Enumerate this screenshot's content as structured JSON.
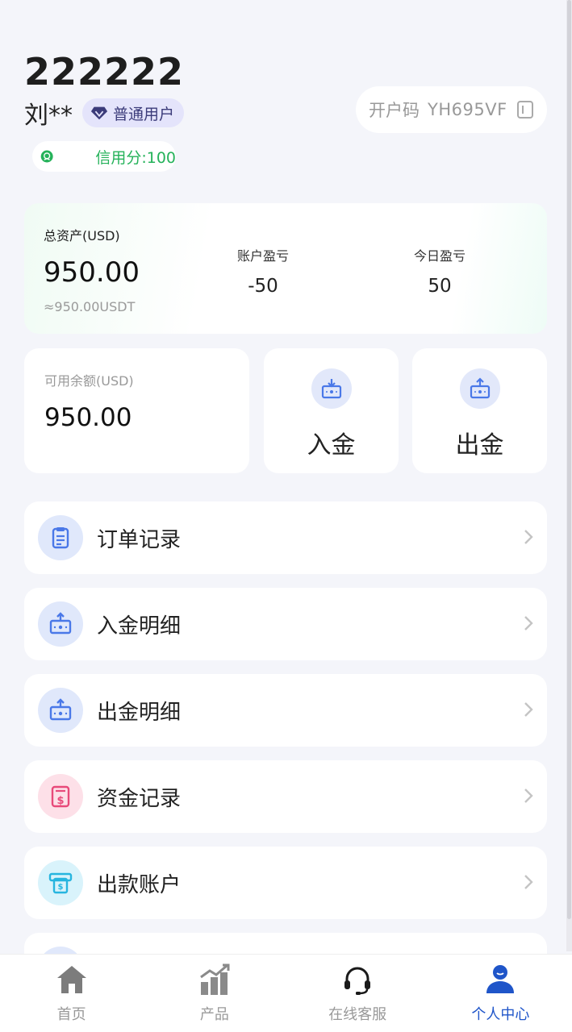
{
  "profile": {
    "uid": "222222",
    "name": "刘**",
    "level": "普通用户",
    "credit": "信用分:100",
    "invite_label": "开户码",
    "invite_code": "YH695VF"
  },
  "assets": {
    "total_label": "总资产(USD)",
    "total_value": "950.00",
    "total_usdt": "≈950.00USDT",
    "pnl_label": "账户盈亏",
    "pnl_value": "-50",
    "today_label": "今日盈亏",
    "today_value": "50"
  },
  "available": {
    "label": "可用余额(USD)",
    "value": "950.00"
  },
  "actions": {
    "deposit": "入金",
    "withdraw": "出金"
  },
  "menu": [
    {
      "label": "订单记录",
      "icon": "clipboard-icon"
    },
    {
      "label": "入金明细",
      "icon": "deposit-box-icon"
    },
    {
      "label": "出金明细",
      "icon": "withdraw-box-icon"
    },
    {
      "label": "资金记录",
      "icon": "money-record-icon"
    },
    {
      "label": "出款账户",
      "icon": "atm-card-icon"
    }
  ],
  "tabs": [
    {
      "label": "首页",
      "icon": "home-icon"
    },
    {
      "label": "产品",
      "icon": "chart-icon"
    },
    {
      "label": "在线客服",
      "icon": "headset-icon"
    },
    {
      "label": "个人中心",
      "icon": "user-icon",
      "active": true
    }
  ],
  "colors": {
    "accent": "#1f55c9",
    "credit_green": "#25b25a",
    "icon_blue": "#4a78e8",
    "icon_pink": "#e84a7a",
    "icon_cyan": "#27b5df"
  }
}
